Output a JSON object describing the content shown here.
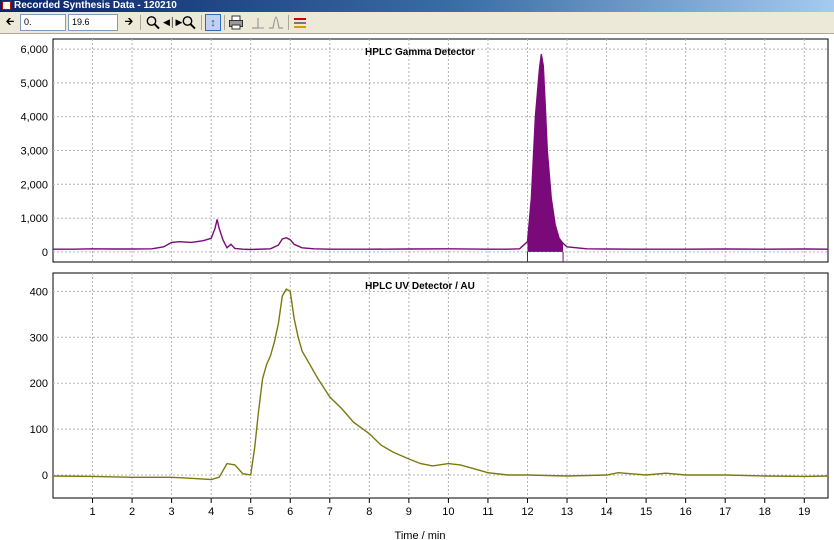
{
  "window": {
    "title": "Recorded Synthesis Data - 120210"
  },
  "toolbar": {
    "x_from_value": "0.",
    "x_to_value": "19.6",
    "icons": [
      "arrow-left-icon",
      "arrow-right-icon",
      "zoom-in-icon",
      "fit-width-icon",
      "zoom-out-icon",
      "vertical-scale-icon",
      "print-icon",
      "peak-marker-icon",
      "peak-shape-icon",
      "legend-icon"
    ]
  },
  "colors": {
    "gamma": "#7a0a7a",
    "uv": "#7a7a10",
    "grid": "#b4b4b4"
  },
  "chart_data": [
    {
      "type": "line",
      "title": "HPLC Gamma Detector",
      "xlabel": "",
      "ylabel": "",
      "xlim": [
        0,
        19.6
      ],
      "ylim": [
        -300,
        6300
      ],
      "yticks": [
        0,
        1000,
        2000,
        3000,
        4000,
        5000,
        6000
      ],
      "ytick_labels": [
        "0",
        "1,000",
        "2,000",
        "3,000",
        "4,000",
        "5,000",
        "6,000"
      ],
      "grid": true,
      "series": [
        {
          "filled_region": [
            12.0,
            12.9
          ],
          "x": [
            0,
            0.5,
            1,
            1.5,
            2,
            2.5,
            2.8,
            3.0,
            3.2,
            3.5,
            3.8,
            4.0,
            4.1,
            4.15,
            4.2,
            4.3,
            4.4,
            4.5,
            4.6,
            4.8,
            5.0,
            5.5,
            5.7,
            5.8,
            5.9,
            6.0,
            6.1,
            6.3,
            6.6,
            7,
            8,
            9,
            10,
            11,
            11.5,
            11.8,
            12.0,
            12.1,
            12.2,
            12.3,
            12.35,
            12.4,
            12.45,
            12.5,
            12.6,
            12.7,
            12.8,
            12.9,
            13.0,
            13.5,
            14,
            15,
            16,
            17,
            18,
            19,
            19.6
          ],
          "y": [
            80,
            80,
            90,
            85,
            85,
            90,
            150,
            280,
            300,
            280,
            330,
            400,
            700,
            960,
            700,
            350,
            120,
            220,
            100,
            80,
            70,
            90,
            200,
            380,
            420,
            360,
            220,
            120,
            90,
            80,
            80,
            85,
            90,
            80,
            80,
            90,
            300,
            1600,
            4000,
            5400,
            5850,
            5500,
            4300,
            3000,
            1600,
            800,
            400,
            250,
            150,
            90,
            85,
            80,
            80,
            85,
            80,
            85,
            80
          ]
        }
      ]
    },
    {
      "type": "line",
      "title": "HPLC UV Detector / AU",
      "xlabel": "Time / min",
      "ylabel": "",
      "xlim": [
        0,
        19.6
      ],
      "ylim": [
        -50,
        440
      ],
      "yticks": [
        0,
        100,
        200,
        300,
        400
      ],
      "xticks": [
        1,
        2,
        3,
        4,
        5,
        6,
        7,
        8,
        9,
        10,
        11,
        12,
        13,
        14,
        15,
        16,
        17,
        18,
        19
      ],
      "grid": true,
      "series": [
        {
          "x": [
            0,
            1,
            2,
            3,
            3.5,
            4.0,
            4.2,
            4.4,
            4.6,
            4.8,
            5.0,
            5.1,
            5.2,
            5.3,
            5.4,
            5.5,
            5.6,
            5.7,
            5.8,
            5.9,
            6.0,
            6.1,
            6.2,
            6.3,
            6.5,
            6.7,
            7.0,
            7.3,
            7.6,
            8.0,
            8.3,
            8.6,
            9.0,
            9.3,
            9.6,
            10.0,
            10.3,
            10.6,
            11.0,
            11.5,
            12,
            13,
            14,
            14.3,
            15,
            15.5,
            16,
            17,
            18,
            19,
            19.6
          ],
          "y": [
            -2,
            -3,
            -5,
            -5,
            -7,
            -10,
            -5,
            25,
            22,
            3,
            0,
            60,
            140,
            210,
            240,
            260,
            290,
            330,
            390,
            405,
            400,
            340,
            300,
            270,
            240,
            210,
            170,
            145,
            115,
            90,
            65,
            50,
            35,
            25,
            20,
            25,
            22,
            15,
            5,
            0,
            0,
            -2,
            0,
            5,
            0,
            4,
            0,
            0,
            -2,
            -3,
            -2
          ]
        }
      ]
    }
  ]
}
